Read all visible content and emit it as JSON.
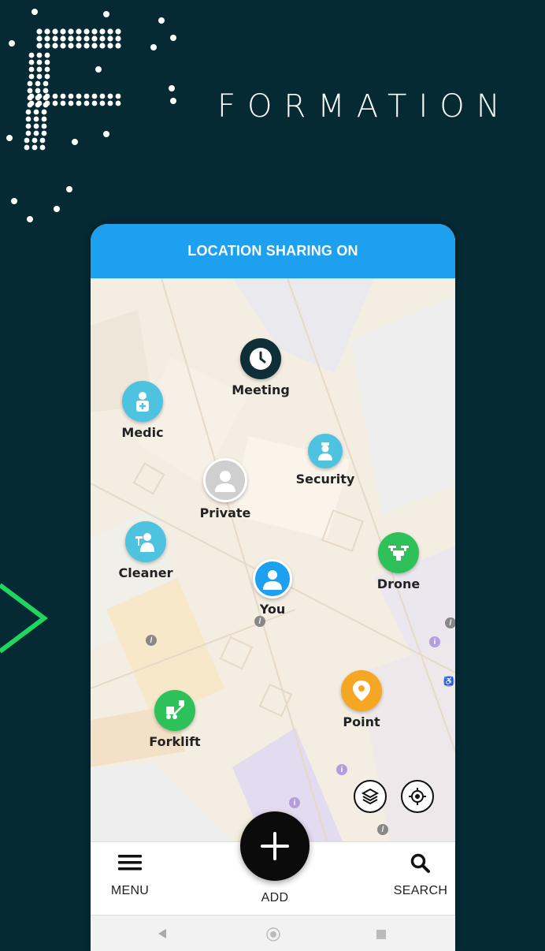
{
  "brand": {
    "name": "FORMATION"
  },
  "banner": {
    "text": "LOCATION SHARING ON"
  },
  "pins": {
    "meeting": {
      "label": "Meeting",
      "icon": "clock-icon",
      "color": "#0f2f38"
    },
    "medic": {
      "label": "Medic",
      "icon": "medic-icon",
      "color": "#4ec3e0"
    },
    "security": {
      "label": "Security",
      "icon": "security-guard-icon",
      "color": "#4ec3e0"
    },
    "private": {
      "label": "Private",
      "icon": "person-icon",
      "color": "#cfcfcf"
    },
    "cleaner": {
      "label": "Cleaner",
      "icon": "cleaner-icon",
      "color": "#4ec3e0"
    },
    "drone": {
      "label": "Drone",
      "icon": "drone-icon",
      "color": "#2ec15a"
    },
    "you": {
      "label": "You",
      "icon": "person-icon",
      "color": "#1ea0f0"
    },
    "point": {
      "label": "Point",
      "icon": "map-pin-icon",
      "color": "#f5a623"
    },
    "forklift": {
      "label": "Forklift",
      "icon": "forklift-icon",
      "color": "#2ec15a"
    }
  },
  "map_controls": {
    "layers_icon": "layers-icon",
    "locate_icon": "locate-icon"
  },
  "bottom_nav": {
    "menu_label": "MENU",
    "add_label": "ADD",
    "search_label": "SEARCH"
  },
  "system_nav": {
    "back_icon": "back-icon",
    "home_icon": "home-icon",
    "recents_icon": "recents-icon"
  }
}
